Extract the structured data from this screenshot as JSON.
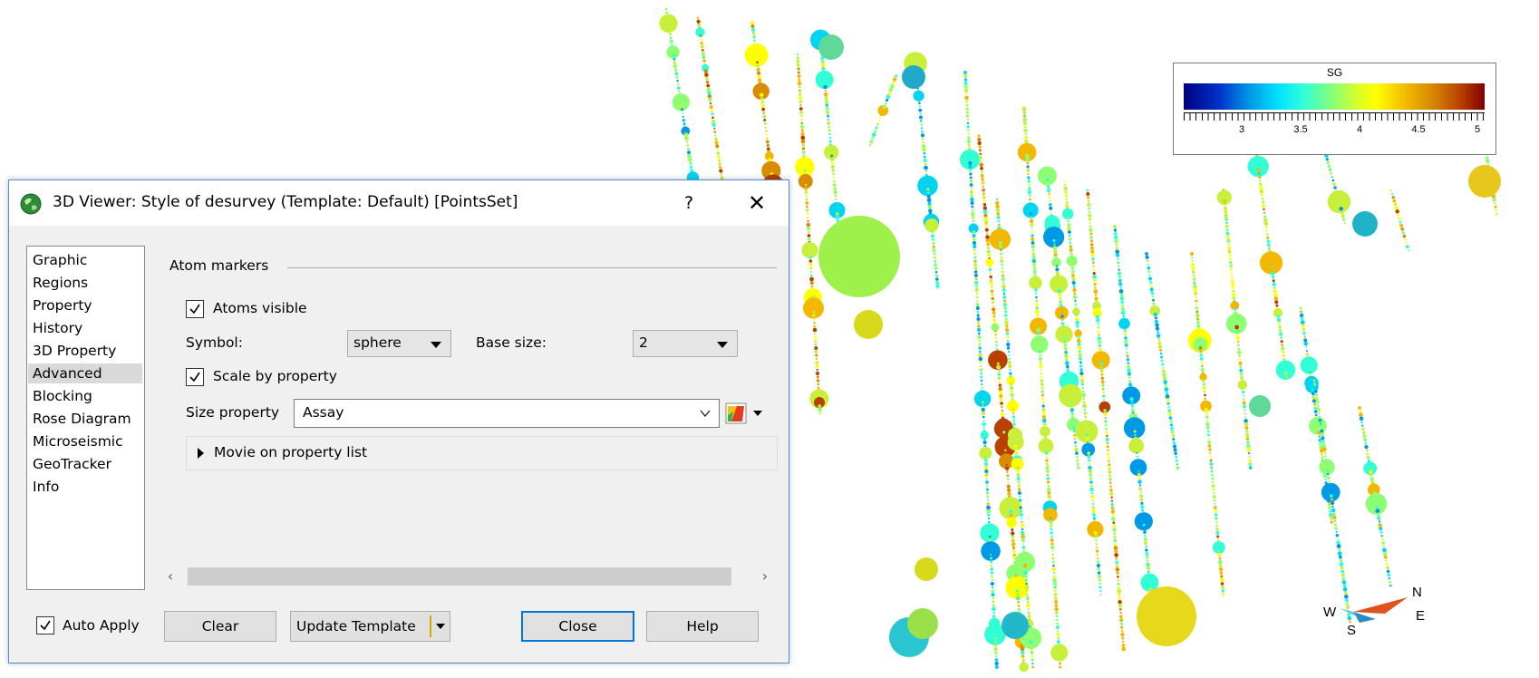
{
  "dialog": {
    "title": "3D Viewer: Style of desurvey (Template: Default) [PointsSet]",
    "help_glyph": "?",
    "close_glyph": "✕",
    "nav_items": [
      "Graphic",
      "Regions",
      "Property",
      "History",
      "3D Property",
      "Advanced",
      "Blocking",
      "Rose Diagram",
      "Microseismic",
      "GeoTracker",
      "Info"
    ],
    "selected_nav": "Advanced",
    "group_title": "Atom markers",
    "atoms_visible": {
      "label": "Atoms visible",
      "checked": true
    },
    "symbol": {
      "label": "Symbol:",
      "value": "sphere"
    },
    "base_size": {
      "label": "Base size:",
      "value": "2"
    },
    "scale_by_property": {
      "label": "Scale by property",
      "checked": true
    },
    "size_property": {
      "label": "Size property",
      "value": "Assay"
    },
    "movie_label": "Movie on property list",
    "auto_apply": {
      "label": "Auto Apply",
      "checked": true
    },
    "buttons": {
      "clear": "Clear",
      "update_template": "Update Template",
      "close": "Close",
      "help": "Help"
    }
  },
  "legend": {
    "title": "SG",
    "tick_labels": [
      "3",
      "3.5",
      "4",
      "4.5",
      "5"
    ],
    "colors": [
      "#00007f",
      "#00e5ff",
      "#8cff73",
      "#ffff00",
      "#d98c00",
      "#7f0000"
    ]
  },
  "compass": {
    "n": "N",
    "e": "E",
    "s": "S",
    "w": "W"
  },
  "accent": "#0078d7"
}
